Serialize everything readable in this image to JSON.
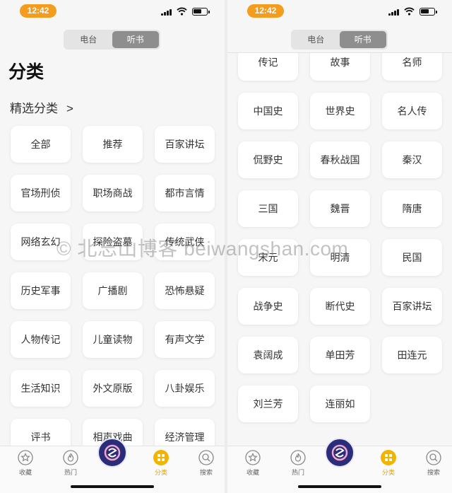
{
  "status_bar": {
    "time": "12:42"
  },
  "segmented": {
    "options": [
      "电台",
      "听书"
    ],
    "selected": "听书"
  },
  "left_screen": {
    "title": "分类",
    "section_title": "精选分类",
    "section_chevron": ">",
    "categories": [
      "全部",
      "推荐",
      "百家讲坛",
      "官场刑侦",
      "职场商战",
      "都市言情",
      "网络玄幻",
      "探险盗墓",
      "传统武侠",
      "历史军事",
      "广播剧",
      "恐怖悬疑",
      "人物传记",
      "儿童读物",
      "有声文学",
      "生活知识",
      "外文原版",
      "八卦娱乐",
      "评书",
      "相声戏曲",
      "经济管理"
    ]
  },
  "right_screen": {
    "categories": [
      "传记",
      "故事",
      "名师",
      "中国史",
      "世界史",
      "名人传",
      "侃野史",
      "春秋战国",
      "秦汉",
      "三国",
      "魏晋",
      "隋唐",
      "宋元",
      "明清",
      "民国",
      "战争史",
      "断代史",
      "百家讲坛",
      "袁阔成",
      "单田芳",
      "田连元",
      "刘兰芳",
      "连丽如"
    ]
  },
  "tabbar": {
    "tabs": [
      {
        "label": "收藏",
        "icon": "star-icon"
      },
      {
        "label": "热门",
        "icon": "flame-icon"
      },
      {
        "label": "",
        "icon": "app-logo-icon"
      },
      {
        "label": "分类",
        "icon": "grid-icon",
        "active": true
      },
      {
        "label": "搜索",
        "icon": "search-icon"
      }
    ]
  },
  "watermark": "© 北忘山博客 beiwangshan.com",
  "colors": {
    "accent": "#f39c1d",
    "active_tab": "#e4a400",
    "segment_active": "#8e8e8e"
  }
}
